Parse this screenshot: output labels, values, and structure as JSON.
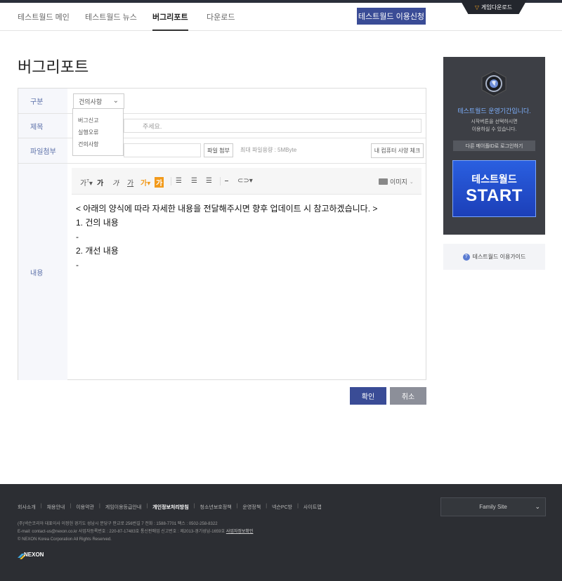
{
  "nav": {
    "items": [
      "테스트월드 메인",
      "테스트월드 뉴스",
      "버그리포트",
      "다운로드"
    ],
    "active_index": 2,
    "apply_button": "테스트월드 이용신청",
    "download_badge": "게임다운로드"
  },
  "page": {
    "title": "버그리포트"
  },
  "form": {
    "category_label": "구분",
    "category_selected": "건의사항",
    "category_options": [
      "버그신고",
      "실행오류",
      "건의사항"
    ],
    "title_label": "제목",
    "title_placeholder": "주세요.",
    "attach_label": "파일첨부",
    "attach_button": "파일 첨부",
    "attach_note": "최대 파일용량 : 5MByte",
    "spec_button": "내 컴퓨터 사양 체크",
    "content_label": "내용",
    "toolbar": {
      "fontsize": "가",
      "bold": "가",
      "italic": "가",
      "underline": "가",
      "strike": "가",
      "color": "가",
      "highlight": "가",
      "image": "이미지"
    },
    "content_lines": [
      "< 아래의 양식에 따라 자세한 내용을 전달해주시면 향후 업데이트 시 참고하겠습니다. >",
      "1. 건의 내용",
      "-",
      "2. 개선 내용",
      "-"
    ]
  },
  "actions": {
    "confirm": "확인",
    "cancel": "취소"
  },
  "side": {
    "status": "테스트월드 운영기간입니다.",
    "desc1": "시작버튼을 선택하시면",
    "desc2": "이용하실 수 있습니다.",
    "login": "다른 메이플ID로 로그인하기",
    "start_line1": "테스트월드",
    "start_line2": "START",
    "guide": "테스트월드 이용가이드"
  },
  "footer": {
    "links": [
      "회사소개",
      "채용안내",
      "이용약관",
      "게임이용등급안내",
      "개인정보처리방침",
      "청소년보호정책",
      "운영정책",
      "넥슨PC방",
      "사이트맵"
    ],
    "info1": "(주)넥슨코리아 대표이사 이정헌 경기도 성남시 분당구 판교로 256번길 7 전화 : 1588-7701 팩스 : 0502-258-8322",
    "info2": "E-mail: contact-us@nexon.co.kr 사업자등록번호 : 220-87-17483호 통신판매업 신고번호 : 제2013-경기성남-1659호",
    "info2_link": "사업자정보확인",
    "copyright": "© NEXON Korea Corporation All Rights Reserved.",
    "logo": "NEXON",
    "family_site": "Family Site"
  },
  "colors": {
    "primary": "#3a4c96",
    "accent": "#f29a1b",
    "label": "#5a6fa8",
    "footer_bg": "#2c2e33"
  }
}
